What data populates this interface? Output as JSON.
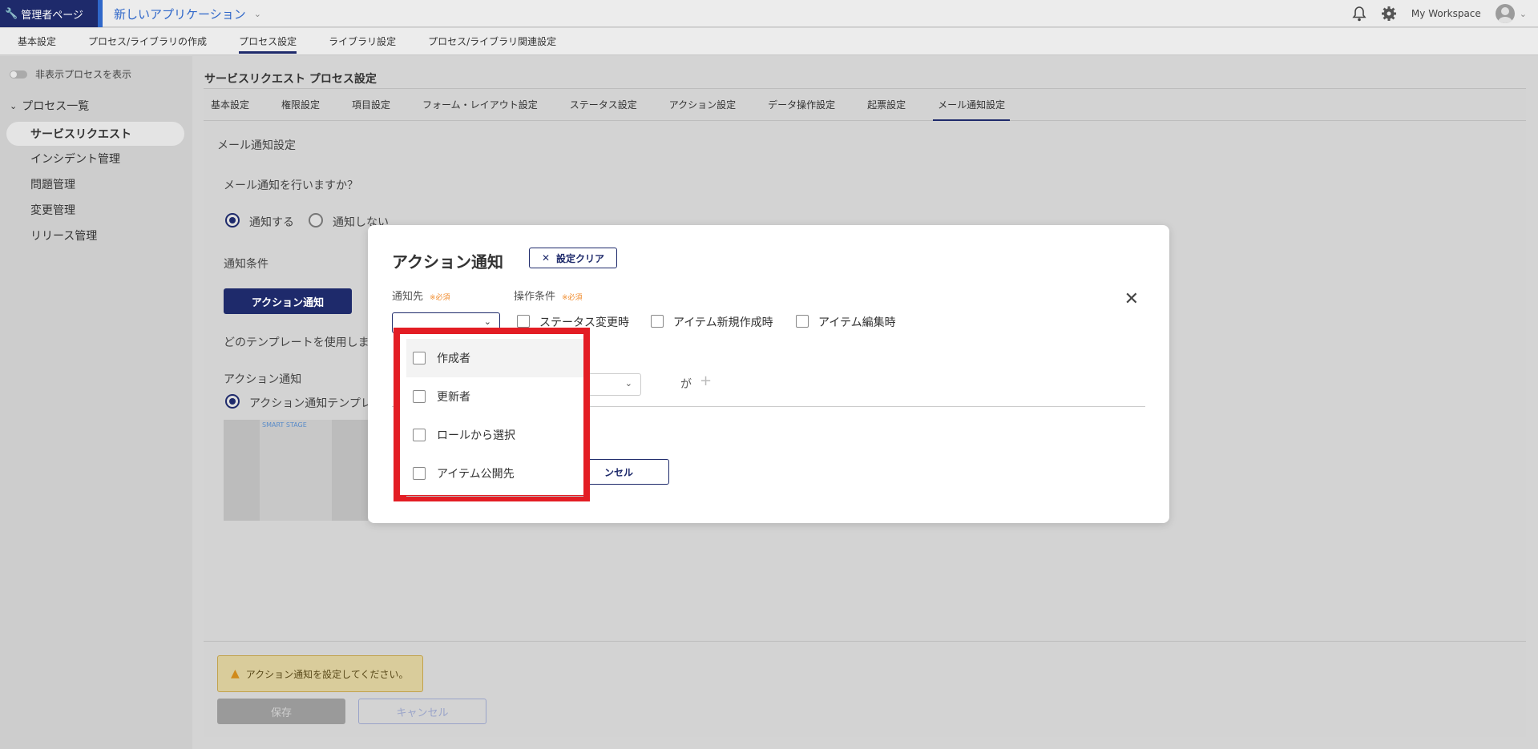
{
  "topbar": {
    "admin_label": "管理者ページ",
    "app_name": "新しいアプリケーション",
    "workspace": "My Workspace"
  },
  "main_tabs": [
    "基本設定",
    "プロセス/ライブラリの作成",
    "プロセス設定",
    "ライブラリ設定",
    "プロセス/ライブラリ関連設定"
  ],
  "main_tab_active": "プロセス設定",
  "sidebar": {
    "toggle_label": "非表示プロセスを表示",
    "section": "プロセス一覧",
    "items": [
      "サービスリクエスト",
      "インシデント管理",
      "問題管理",
      "変更管理",
      "リリース管理"
    ],
    "active": "サービスリクエスト"
  },
  "content": {
    "title": "サービスリクエスト プロセス設定",
    "sub_tabs": [
      "基本設定",
      "権限設定",
      "項目設定",
      "フォーム・レイアウト設定",
      "ステータス設定",
      "アクション設定",
      "データ操作設定",
      "起票設定",
      "メール通知設定"
    ],
    "sub_tab_active": "メール通知設定",
    "section_title": "メール通知設定",
    "question": "メール通知を行いますか？",
    "radio_yes": "通知する",
    "radio_no": "通知しない",
    "condition_label": "通知条件",
    "action_button": "アクション通知",
    "template_question": "どのテンプレートを使用しま",
    "template_group": "アクション通知",
    "template_option": "アクション通知テンプレ",
    "thumb_brand": "SMART STAGE",
    "warning": "アクション通知を設定してください。",
    "save": "保存",
    "cancel": "キャンセル"
  },
  "modal": {
    "title": "アクション通知",
    "clear_button": "設定クリア",
    "notify_to_label": "通知先",
    "operation_label": "操作条件",
    "required": "※必須",
    "operation_options": [
      "ステータス変更時",
      "アイテム新規作成時",
      "アイテム編集時"
    ],
    "ga": "が",
    "cancel_button": "ンセル"
  },
  "dropdown": {
    "items": [
      "作成者",
      "更新者",
      "ロールから選択",
      "アイテム公開先"
    ],
    "highlight_color": "#e31d24"
  },
  "colors": {
    "primary": "#1e2a6b",
    "link": "#2f67c9",
    "warning_bg": "#d9cc9b",
    "required": "#f08a2a"
  }
}
